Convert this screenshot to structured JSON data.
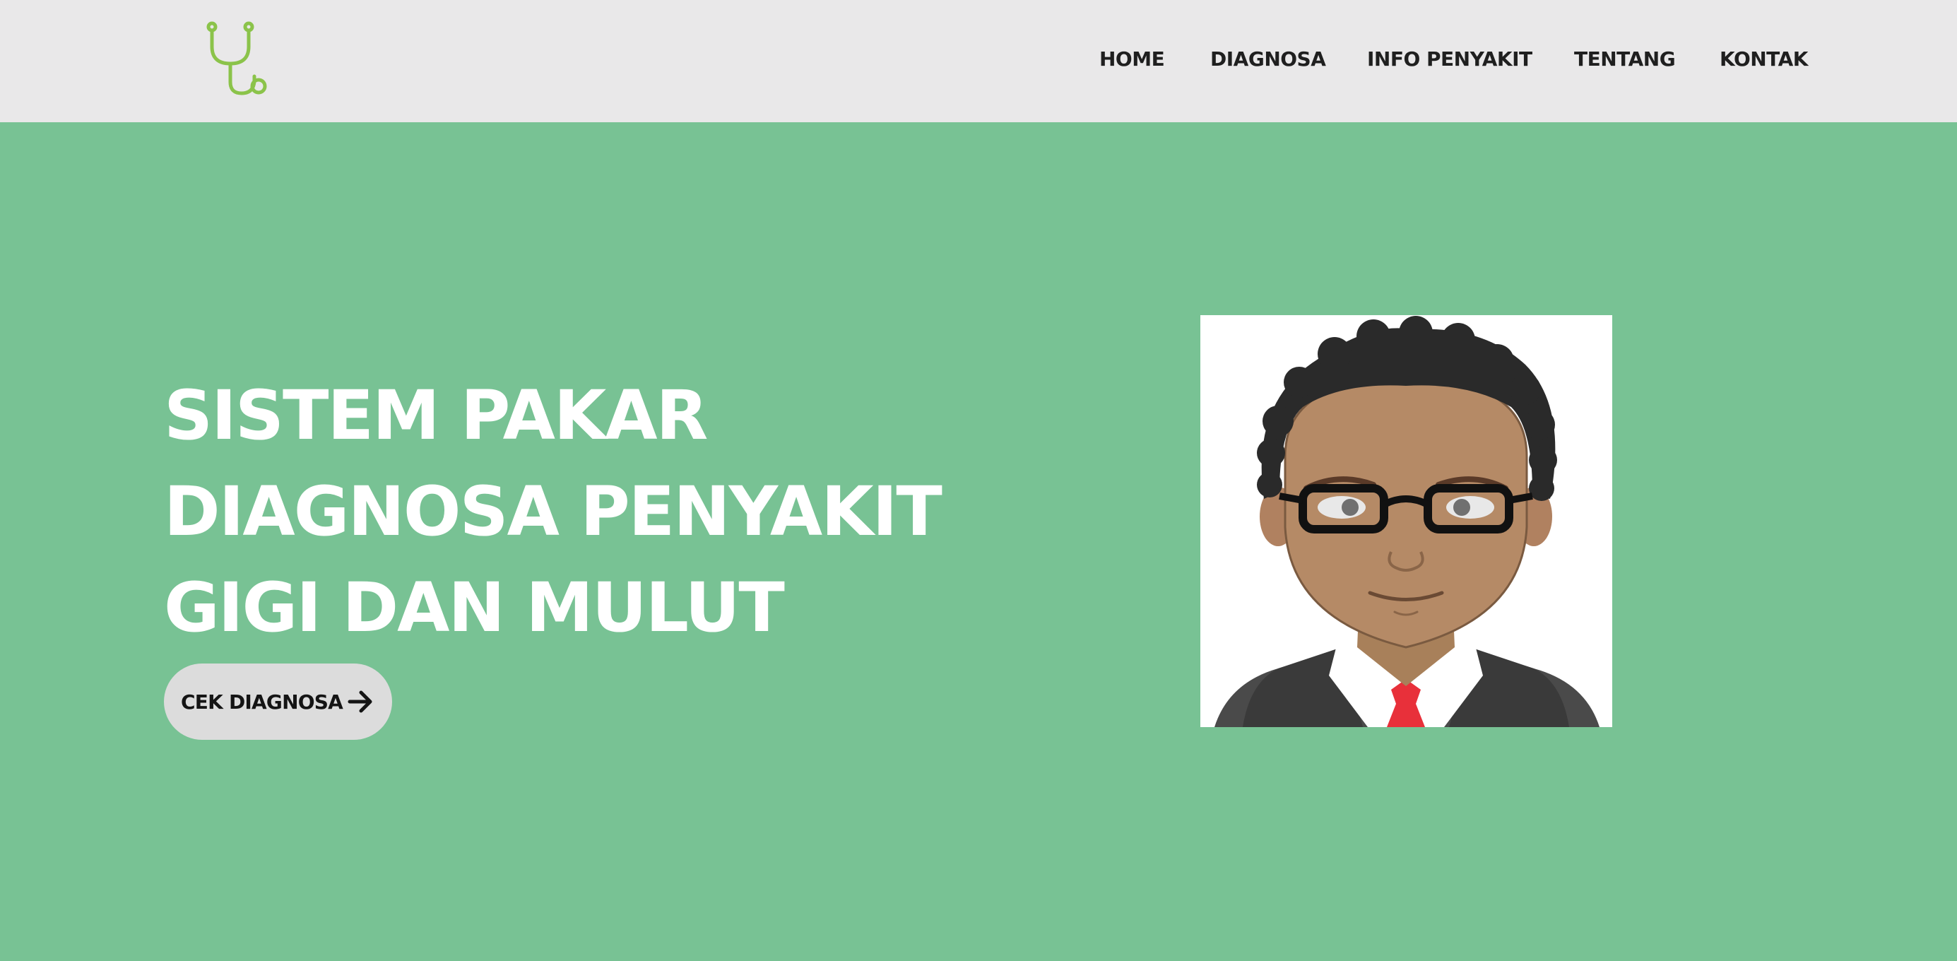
{
  "nav": {
    "items": [
      {
        "label": "HOME"
      },
      {
        "label": "DIAGNOSA"
      },
      {
        "label": "INFO PENYAKIT"
      },
      {
        "label": "TENTANG"
      },
      {
        "label": "KONTAK"
      }
    ]
  },
  "logo": {
    "icon": "stethoscope-icon",
    "color": "#8bc34a"
  },
  "hero": {
    "title_lines": [
      "SISTEM PAKAR",
      "DIAGNOSA PENYAKIT",
      "GIGI DAN MULUT"
    ],
    "cta_label": "CEK DIAGNOSA",
    "cta_icon": "arrow-right-icon"
  },
  "colors": {
    "hero_background": "#78c294",
    "navbar_background": "#e9e8e9",
    "cta_background": "#dcdcdc"
  }
}
